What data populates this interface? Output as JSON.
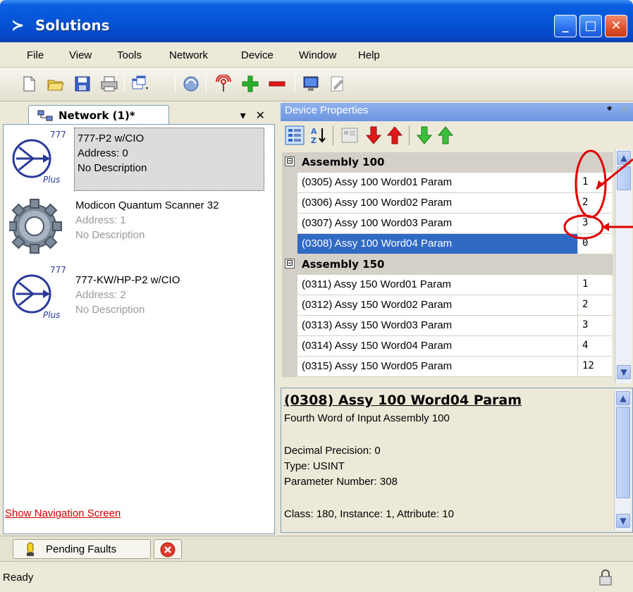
{
  "window": {
    "title": "Solutions",
    "app_icon": "arrow-logo-icon",
    "minimize": "_",
    "maximize": "□",
    "close": "✕"
  },
  "menu": [
    "File",
    "View",
    "Tools",
    "Network",
    "Device",
    "Window",
    "Help"
  ],
  "toolbar": {
    "icons": [
      "new-file-icon",
      "open-folder-icon",
      "save-icon",
      "print-icon",
      "window-dropdown-icon",
      "diagnostic-icon",
      "broadcast-icon",
      "add-icon",
      "remove-icon",
      "monitor-icon",
      "edit-icon"
    ]
  },
  "left": {
    "tab_label": "Network (1)*",
    "dropdown_glyph": "▾",
    "close_glyph": "✕",
    "devices": [
      {
        "name": "777-P2 w/CIO",
        "address": "Address: 0",
        "description": "No Description",
        "icon_label": "777",
        "icon_sub": "Plus",
        "selected": true
      },
      {
        "name": "Modicon Quantum Scanner 32",
        "address": "Address: 1",
        "description": "No Description",
        "icon": "gear-icon",
        "selected": false
      },
      {
        "name": "777-KW/HP-P2 w/CIO",
        "address": "Address: 2",
        "description": "No Description",
        "icon_label": "777",
        "icon_sub": "Plus",
        "selected": false
      }
    ],
    "show_nav_link": "Show Navigation Screen"
  },
  "right": {
    "header_title": "Device Properties",
    "pin_glyph": "ᵠ",
    "close_glyph": "✕",
    "categories": [
      {
        "name": "Assembly 100",
        "expander": "⊟",
        "rows": [
          {
            "name": "(0305) Assy 100 Word01 Param",
            "value": "1"
          },
          {
            "name": "(0306) Assy 100 Word02 Param",
            "value": "2"
          },
          {
            "name": "(0307) Assy 100 Word03 Param",
            "value": "3"
          },
          {
            "name": "(0308) Assy 100 Word04 Param",
            "value": "0",
            "selected": true
          }
        ]
      },
      {
        "name": "Assembly 150",
        "expander": "⊟",
        "rows": [
          {
            "name": "(0311) Assy 150 Word01 Param",
            "value": "1"
          },
          {
            "name": "(0312) Assy 150 Word02 Param",
            "value": "2"
          },
          {
            "name": "(0313) Assy 150 Word03 Param",
            "value": "3"
          },
          {
            "name": "(0314) Assy 150 Word04 Param",
            "value": "4"
          },
          {
            "name": "(0315) Assy 150 Word05 Param",
            "value": "12"
          }
        ]
      }
    ],
    "description": {
      "title": "(0308) Assy 100 Word04 Param",
      "line1": "Fourth Word of Input Assembly 100",
      "precision": "Decimal Precision: 0",
      "type": "Type: USINT",
      "param_number": "Parameter Number: 308",
      "class_info": "Class: 180, Instance: 1, Attribute: 10"
    }
  },
  "bottom": {
    "pending_faults": "Pending Faults",
    "status": "Ready"
  },
  "colors": {
    "title_blue": "#0654d8",
    "selection_blue": "#316ac5",
    "annotation_red": "#e00000",
    "link_red": "#d40000"
  }
}
